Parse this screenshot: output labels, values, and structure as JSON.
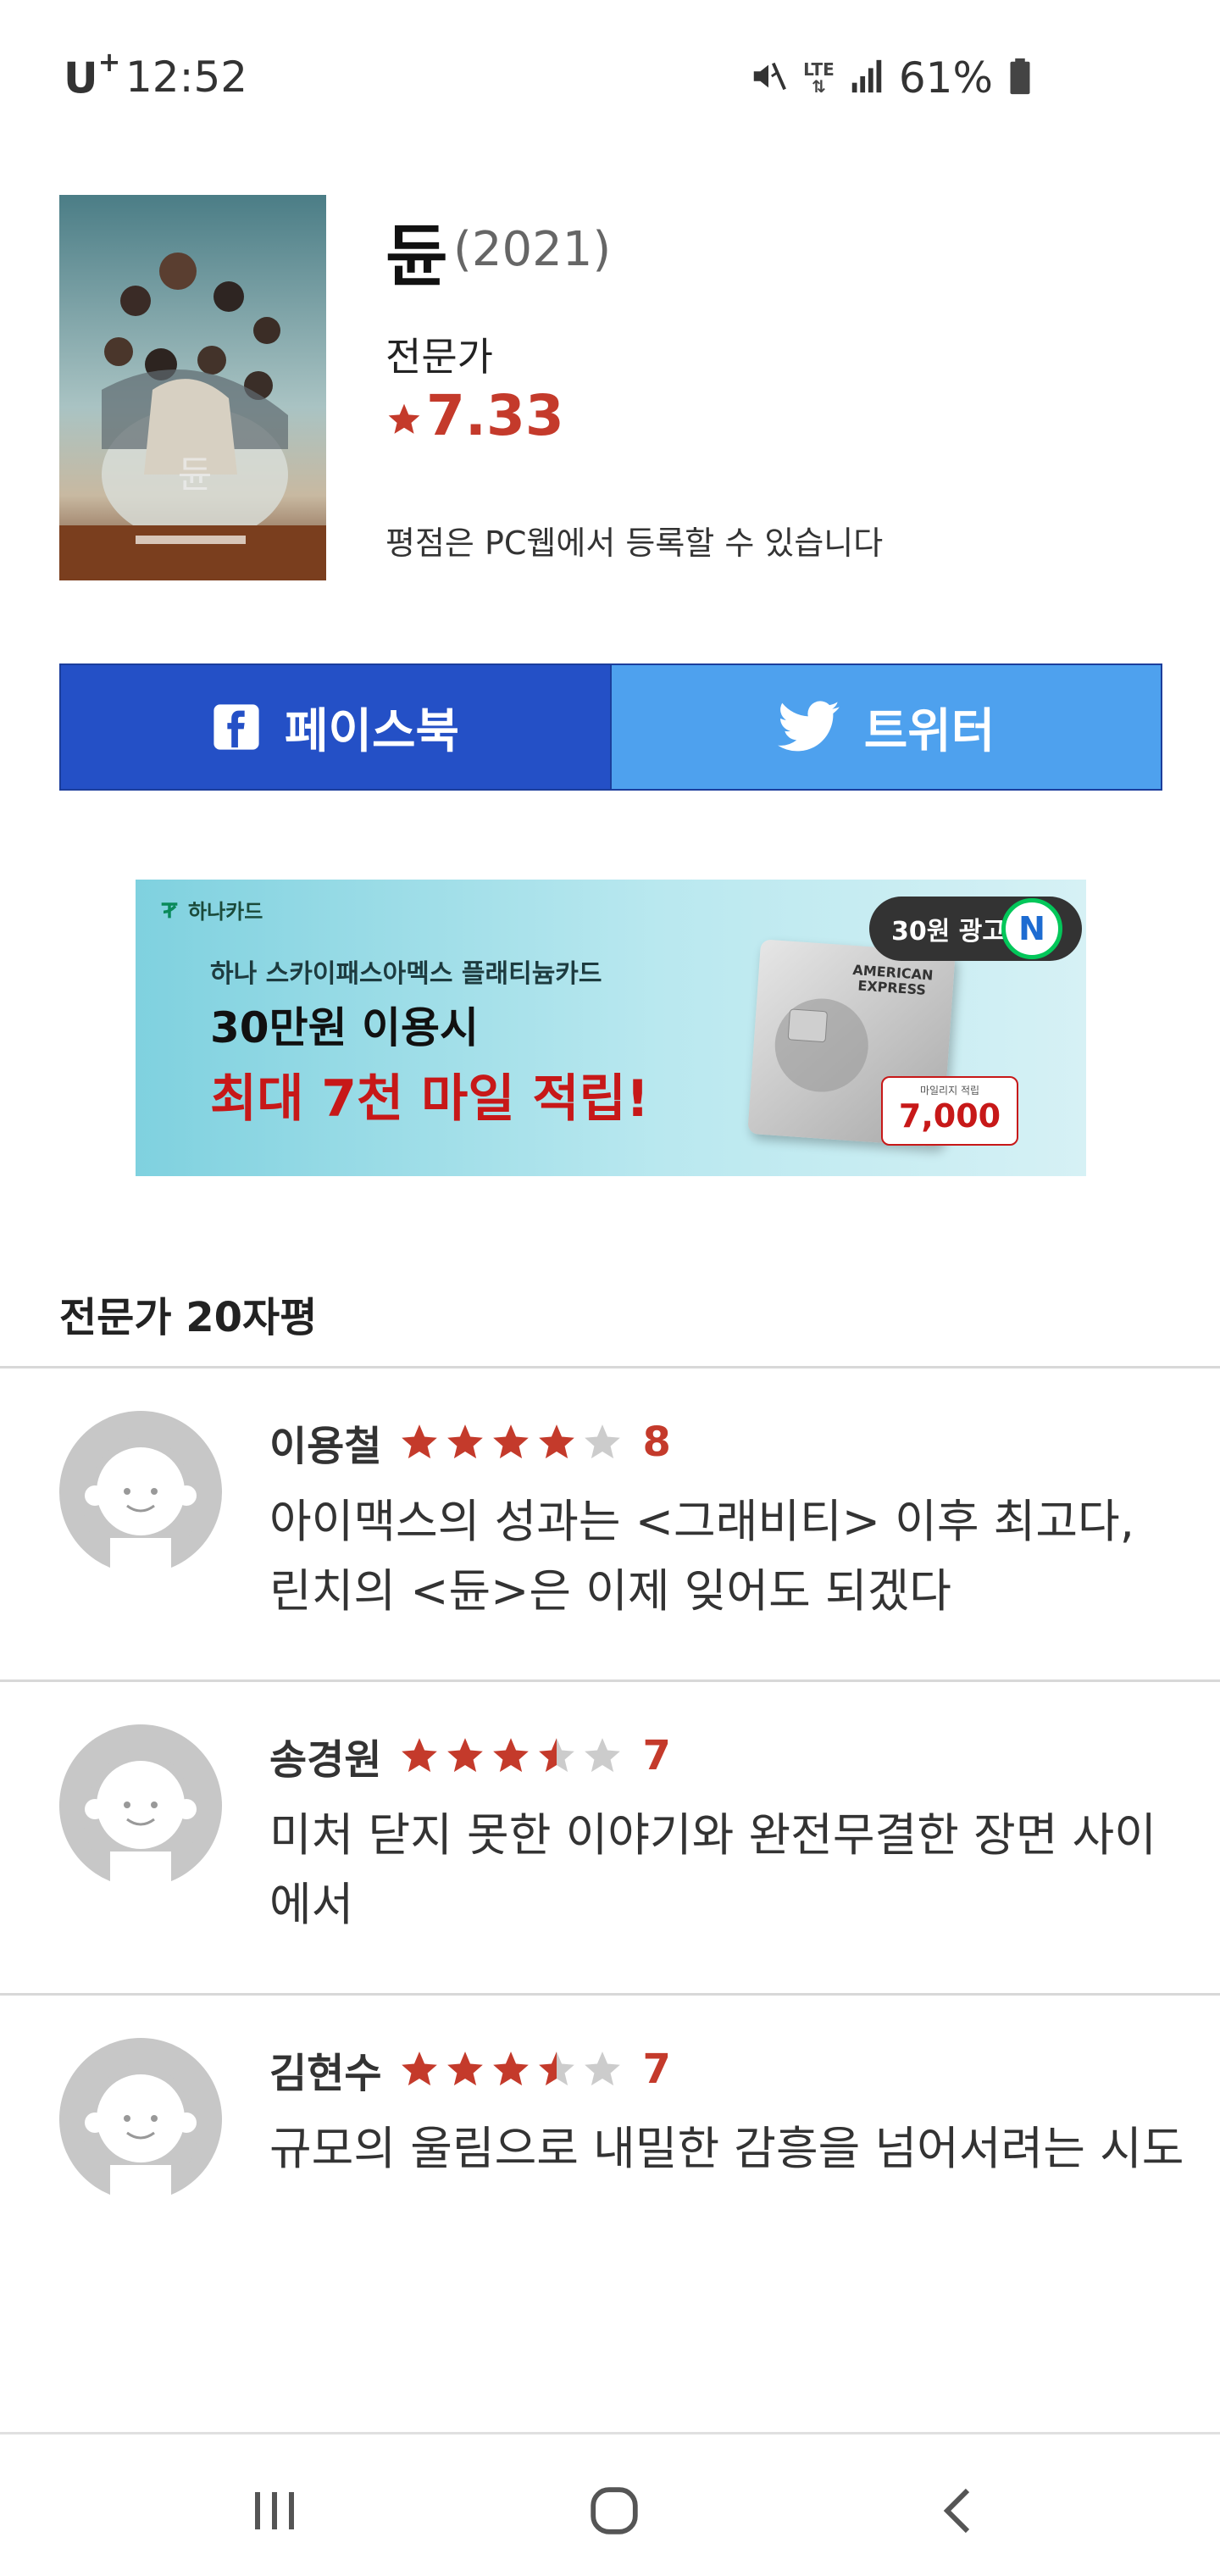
{
  "status_bar": {
    "carrier": "U",
    "carrier_plus": "+",
    "time": "12:52",
    "network": "LTE",
    "battery": "61%",
    "icons": [
      "mute-icon",
      "lte-icon",
      "signal-icon",
      "battery-icon"
    ]
  },
  "movie": {
    "title": "듄",
    "year": "(2021)",
    "critic_label": "전문가",
    "rating": "7.33",
    "rating_notice": "평점은 PC웹에서 등록할 수 있습니다"
  },
  "share": {
    "facebook": "페이스북",
    "twitter": "트위터"
  },
  "ad": {
    "brand": "하나카드",
    "line1": "하나 스카이패스아멕스 플래티늄카드",
    "line2": "30만원 이용시",
    "line3": "최대 7천 마일 적립!",
    "badge": "30원 광고",
    "badge_n": "N",
    "card_text": "AMERICAN EXPRESS",
    "mile_label": "마일리지 적립",
    "mile_value": "7,000"
  },
  "reviews_section": {
    "title": "전문가 20자평"
  },
  "reviews": [
    {
      "name": "이용철",
      "stars": 4,
      "score": "8",
      "text": "아이맥스의 성과는 <그래비티> 이후 최고다, 린치의 <듄>은 이제 잊어도 되겠다"
    },
    {
      "name": "송경원",
      "stars": 3.5,
      "score": "7",
      "text": "미처 닫지 못한 이야기와 완전무결한 장면 사이에서"
    },
    {
      "name": "김현수",
      "stars": 3.5,
      "score": "7",
      "text": "규모의 울림으로 내밀한 감흥을 넘어서려는 시도"
    }
  ],
  "colors": {
    "accent_red": "#c43a2b",
    "facebook_blue": "#2450c6",
    "twitter_blue": "#4ea1ee",
    "star_empty": "#cccccc"
  },
  "nav": {
    "icons": [
      "recent-apps-icon",
      "home-icon",
      "back-icon"
    ]
  }
}
